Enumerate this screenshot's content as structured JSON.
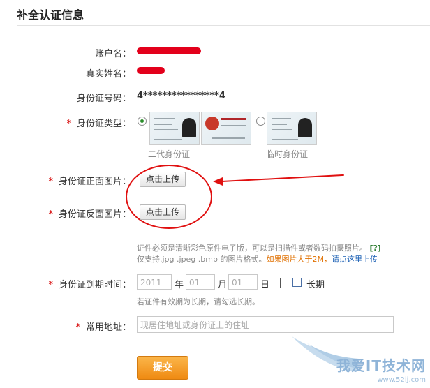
{
  "header": {
    "title": "补全认证信息"
  },
  "account": {
    "label": "账户名："
  },
  "realname": {
    "label": "真实姓名："
  },
  "idnumber": {
    "label": "身份证号码：",
    "value": "4****************4"
  },
  "idtype": {
    "required_mark": "*",
    "label": "身份证类型：",
    "options": [
      {
        "label": "二代身份证",
        "selected": true
      },
      {
        "label": "临时身份证",
        "selected": false
      }
    ]
  },
  "front_image": {
    "required_mark": "*",
    "label": "身份证正面图片：",
    "button": "点击上传"
  },
  "back_image": {
    "required_mark": "*",
    "label": "身份证反面图片：",
    "button": "点击上传"
  },
  "upload_hint": {
    "line1": "证件必须是清晰彩色原件电子版，可以是扫描件或者数码拍摄照片。",
    "help": "[?]",
    "line2_a": "仅支持.jpg .jpeg .bmp 的图片格式。",
    "line2_warn": "如果图片大于2M，",
    "line2_link": "请点这里上传"
  },
  "expiry": {
    "required_mark": "*",
    "label": "身份证到期时间：",
    "year_placeholder": "2011",
    "year_unit": "年",
    "month_placeholder": "01",
    "month_unit": "月",
    "day_placeholder": "01",
    "day_unit": "日",
    "longterm_label": "长期",
    "hint": "若证件有效期为长期，请勾选长期。"
  },
  "address": {
    "required_mark": "*",
    "label": "常用地址：",
    "placeholder": "现居住地址或身份证上的住址"
  },
  "submit": {
    "label": "提交"
  },
  "watermark": {
    "text": "我爱IT技术网",
    "url": "www.52ij.com"
  },
  "colors": {
    "required": "#d60000",
    "annotation": "#e01010",
    "submit": "#ef8a12",
    "link": "#1a5fb4",
    "warn": "#e07000"
  }
}
